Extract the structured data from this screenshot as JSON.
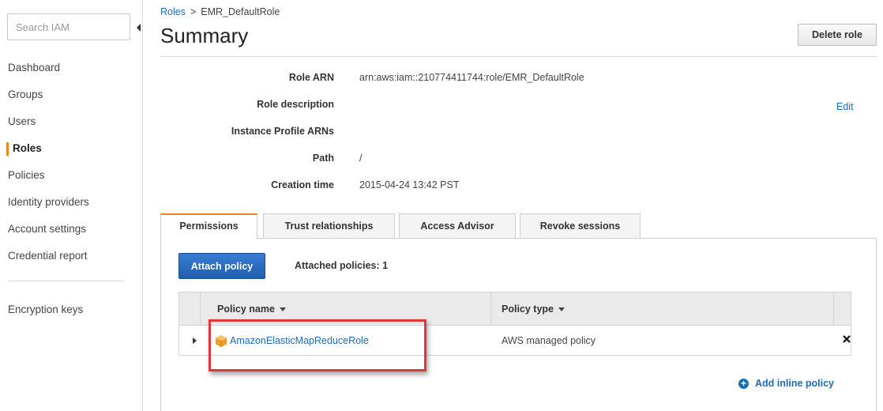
{
  "sidebar": {
    "search_placeholder": "Search IAM",
    "items": [
      {
        "label": "Dashboard"
      },
      {
        "label": "Groups"
      },
      {
        "label": "Users"
      },
      {
        "label": "Roles",
        "active": true
      },
      {
        "label": "Policies"
      },
      {
        "label": "Identity providers"
      },
      {
        "label": "Account settings"
      },
      {
        "label": "Credential report"
      }
    ],
    "extra": "Encryption keys"
  },
  "breadcrumb": {
    "parent": "Roles",
    "separator": ">",
    "current": "EMR_DefaultRole"
  },
  "header": {
    "title": "Summary",
    "delete_label": "Delete role"
  },
  "details": {
    "role_arn_label": "Role ARN",
    "role_arn_value": "arn:aws:iam::210774411744:role/EMR_DefaultRole",
    "description_label": "Role description",
    "edit_label": "Edit",
    "instance_profile_label": "Instance Profile ARNs",
    "path_label": "Path",
    "path_value": "/",
    "creation_label": "Creation time",
    "creation_value": "2015-04-24 13:42 PST"
  },
  "tabs": [
    {
      "label": "Permissions",
      "active": true
    },
    {
      "label": "Trust relationships"
    },
    {
      "label": "Access Advisor"
    },
    {
      "label": "Revoke sessions"
    }
  ],
  "permissions": {
    "attach_label": "Attach policy",
    "attached_count_label": "Attached policies: 1",
    "columns": {
      "policy_name": "Policy name",
      "policy_type": "Policy type"
    },
    "rows": [
      {
        "name": "AmazonElasticMapReduceRole",
        "type": "AWS managed policy"
      }
    ],
    "add_inline_label": "Add inline policy"
  },
  "colors": {
    "accent_orange": "#e8851d",
    "link_blue": "#1f6cb4",
    "button_blue": "#2a6dc4",
    "highlight_red": "#e2363a"
  }
}
